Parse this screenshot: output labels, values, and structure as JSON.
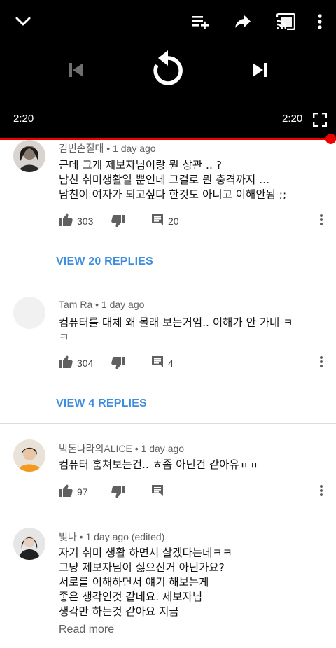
{
  "player": {
    "current_time": "2:20",
    "duration": "2:20",
    "progress": 1.0,
    "icons": [
      "chevron-down-icon",
      "add-to-queue-icon",
      "share-icon",
      "cast-icon",
      "more-vert-icon",
      "skip-previous-icon",
      "replay-icon",
      "skip-next-icon",
      "fullscreen-icon"
    ],
    "progress_color": "#e00000"
  },
  "comments": [
    {
      "author": "김빈손절대",
      "time": "1 day ago",
      "text": "근데 그게 제보자님이랑 뭔 상관 .. ?\n남친 취미생활일 뿐인데 그걸로 뭔 충격까지 ...\n남친이 여자가 되고싶다 한것도 아니고 이해안됨 ;;",
      "likes": "303",
      "replies_count": "20",
      "view_replies": "VIEW 20 REPLIES"
    },
    {
      "author": "Tam Ra",
      "time": "1 day ago",
      "text": "컴퓨터를 대체 왜 몰래 보는거임.. 이해가 안 가네 ㅋ\nㅋ",
      "likes": "304",
      "replies_count": "4",
      "view_replies": "VIEW 4 REPLIES"
    },
    {
      "author": "빅톤나라의ALICE",
      "time": "1 day ago",
      "text": "컴퓨터 훔쳐보는건.. ㅎ좀 아닌건 같아유ㅠㅠ",
      "likes": "97"
    },
    {
      "author": "빛나",
      "time": "1 day ago (edited)",
      "text": "자기 취미 생활 하면서 살겠다는데ㅋㅋ\n그냥 제보자님이 싫으신거 아닌가요?\n서로를 이해하면서 얘기 해보는게\n좋은 생각인것 같네요. 제보자님\n생각만 하는것 같아요 지금",
      "read_more": "Read more"
    }
  ],
  "ui": {
    "accent": "#3e8ee0",
    "meta_separator": " • "
  }
}
